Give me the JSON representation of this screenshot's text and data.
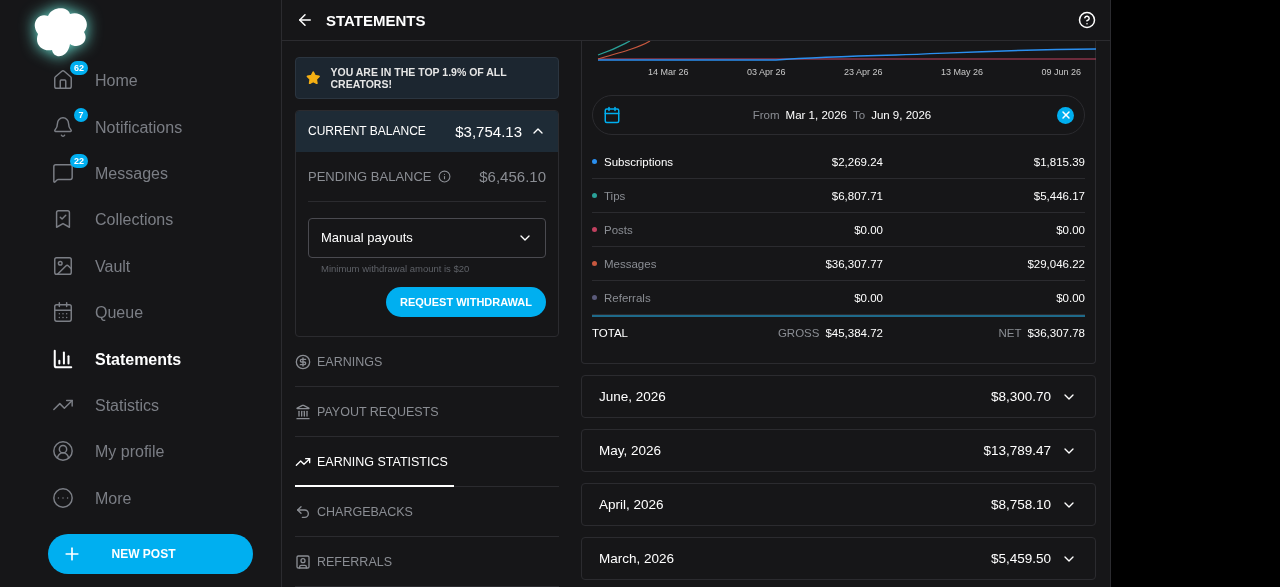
{
  "sidebar": {
    "items": [
      {
        "label": "Home",
        "badge": "62",
        "selected": false
      },
      {
        "label": "Notifications",
        "badge": "7",
        "selected": false
      },
      {
        "label": "Messages",
        "badge": "22",
        "selected": false
      },
      {
        "label": "Collections",
        "selected": false
      },
      {
        "label": "Vault",
        "selected": false
      },
      {
        "label": "Queue",
        "selected": false
      },
      {
        "label": "Statements",
        "selected": true
      },
      {
        "label": "Statistics",
        "selected": false
      },
      {
        "label": "My profile",
        "selected": false
      },
      {
        "label": "More",
        "selected": false
      }
    ],
    "new_post_button": "NEW POST"
  },
  "header": {
    "title": "STATEMENTS"
  },
  "banner": {
    "text": "YOU ARE IN THE TOP 1.9% OF ALL CREATORS!"
  },
  "balance": {
    "current_label": "CURRENT BALANCE",
    "current_value": "$3,754.13",
    "expanded": true,
    "pending_label": "PENDING BALANCE",
    "pending_value": "$6,456.10",
    "payout_select": "Manual payouts",
    "hint": "Minimum withdrawal amount is $20",
    "button": "REQUEST WITHDRAWAL"
  },
  "tabs": [
    {
      "label": "EARNINGS",
      "selected": false
    },
    {
      "label": "PAYOUT REQUESTS",
      "selected": false
    },
    {
      "label": "EARNING STATISTICS",
      "selected": true
    },
    {
      "label": "CHARGEBACKS",
      "selected": false
    },
    {
      "label": "REFERRALS",
      "selected": false
    }
  ],
  "chart": {
    "axis_labels": [
      "14 Mar 26",
      "03 Apr 26",
      "23 Apr 26",
      "13 May 26",
      "09 Jun 26"
    ]
  },
  "date_range": {
    "from_label": "From",
    "from": "Mar 1, 2026",
    "to_label": "To",
    "to": "Jun 9, 2026"
  },
  "categories": [
    {
      "name": "Subscriptions",
      "gross": "$2,269.24",
      "net": "$1,815.39",
      "color": "#2a8ff0",
      "selected": true
    },
    {
      "name": "Tips",
      "gross": "$6,807.71",
      "net": "$5,446.17",
      "color": "#2aa198",
      "selected": false
    },
    {
      "name": "Posts",
      "gross": "$0.00",
      "net": "$0.00",
      "color": "#c0405f",
      "selected": false
    },
    {
      "name": "Messages",
      "gross": "$36,307.77",
      "net": "$29,046.22",
      "color": "#c8583f",
      "selected": false
    },
    {
      "name": "Referrals",
      "gross": "$0.00",
      "net": "$0.00",
      "color": "#5a5a7a",
      "selected": false
    }
  ],
  "total": {
    "label": "TOTAL",
    "gross_label": "GROSS",
    "gross": "$45,384.72",
    "net_label": "NET",
    "net": "$36,307.78"
  },
  "months": [
    {
      "label": "June, 2026",
      "amount": "$8,300.70",
      "expanded": false
    },
    {
      "label": "May, 2026",
      "amount": "$13,789.47",
      "expanded": false
    },
    {
      "label": "April, 2026",
      "amount": "$8,758.10",
      "expanded": false
    },
    {
      "label": "March, 2026",
      "amount": "$5,459.50",
      "expanded": false
    }
  ]
}
